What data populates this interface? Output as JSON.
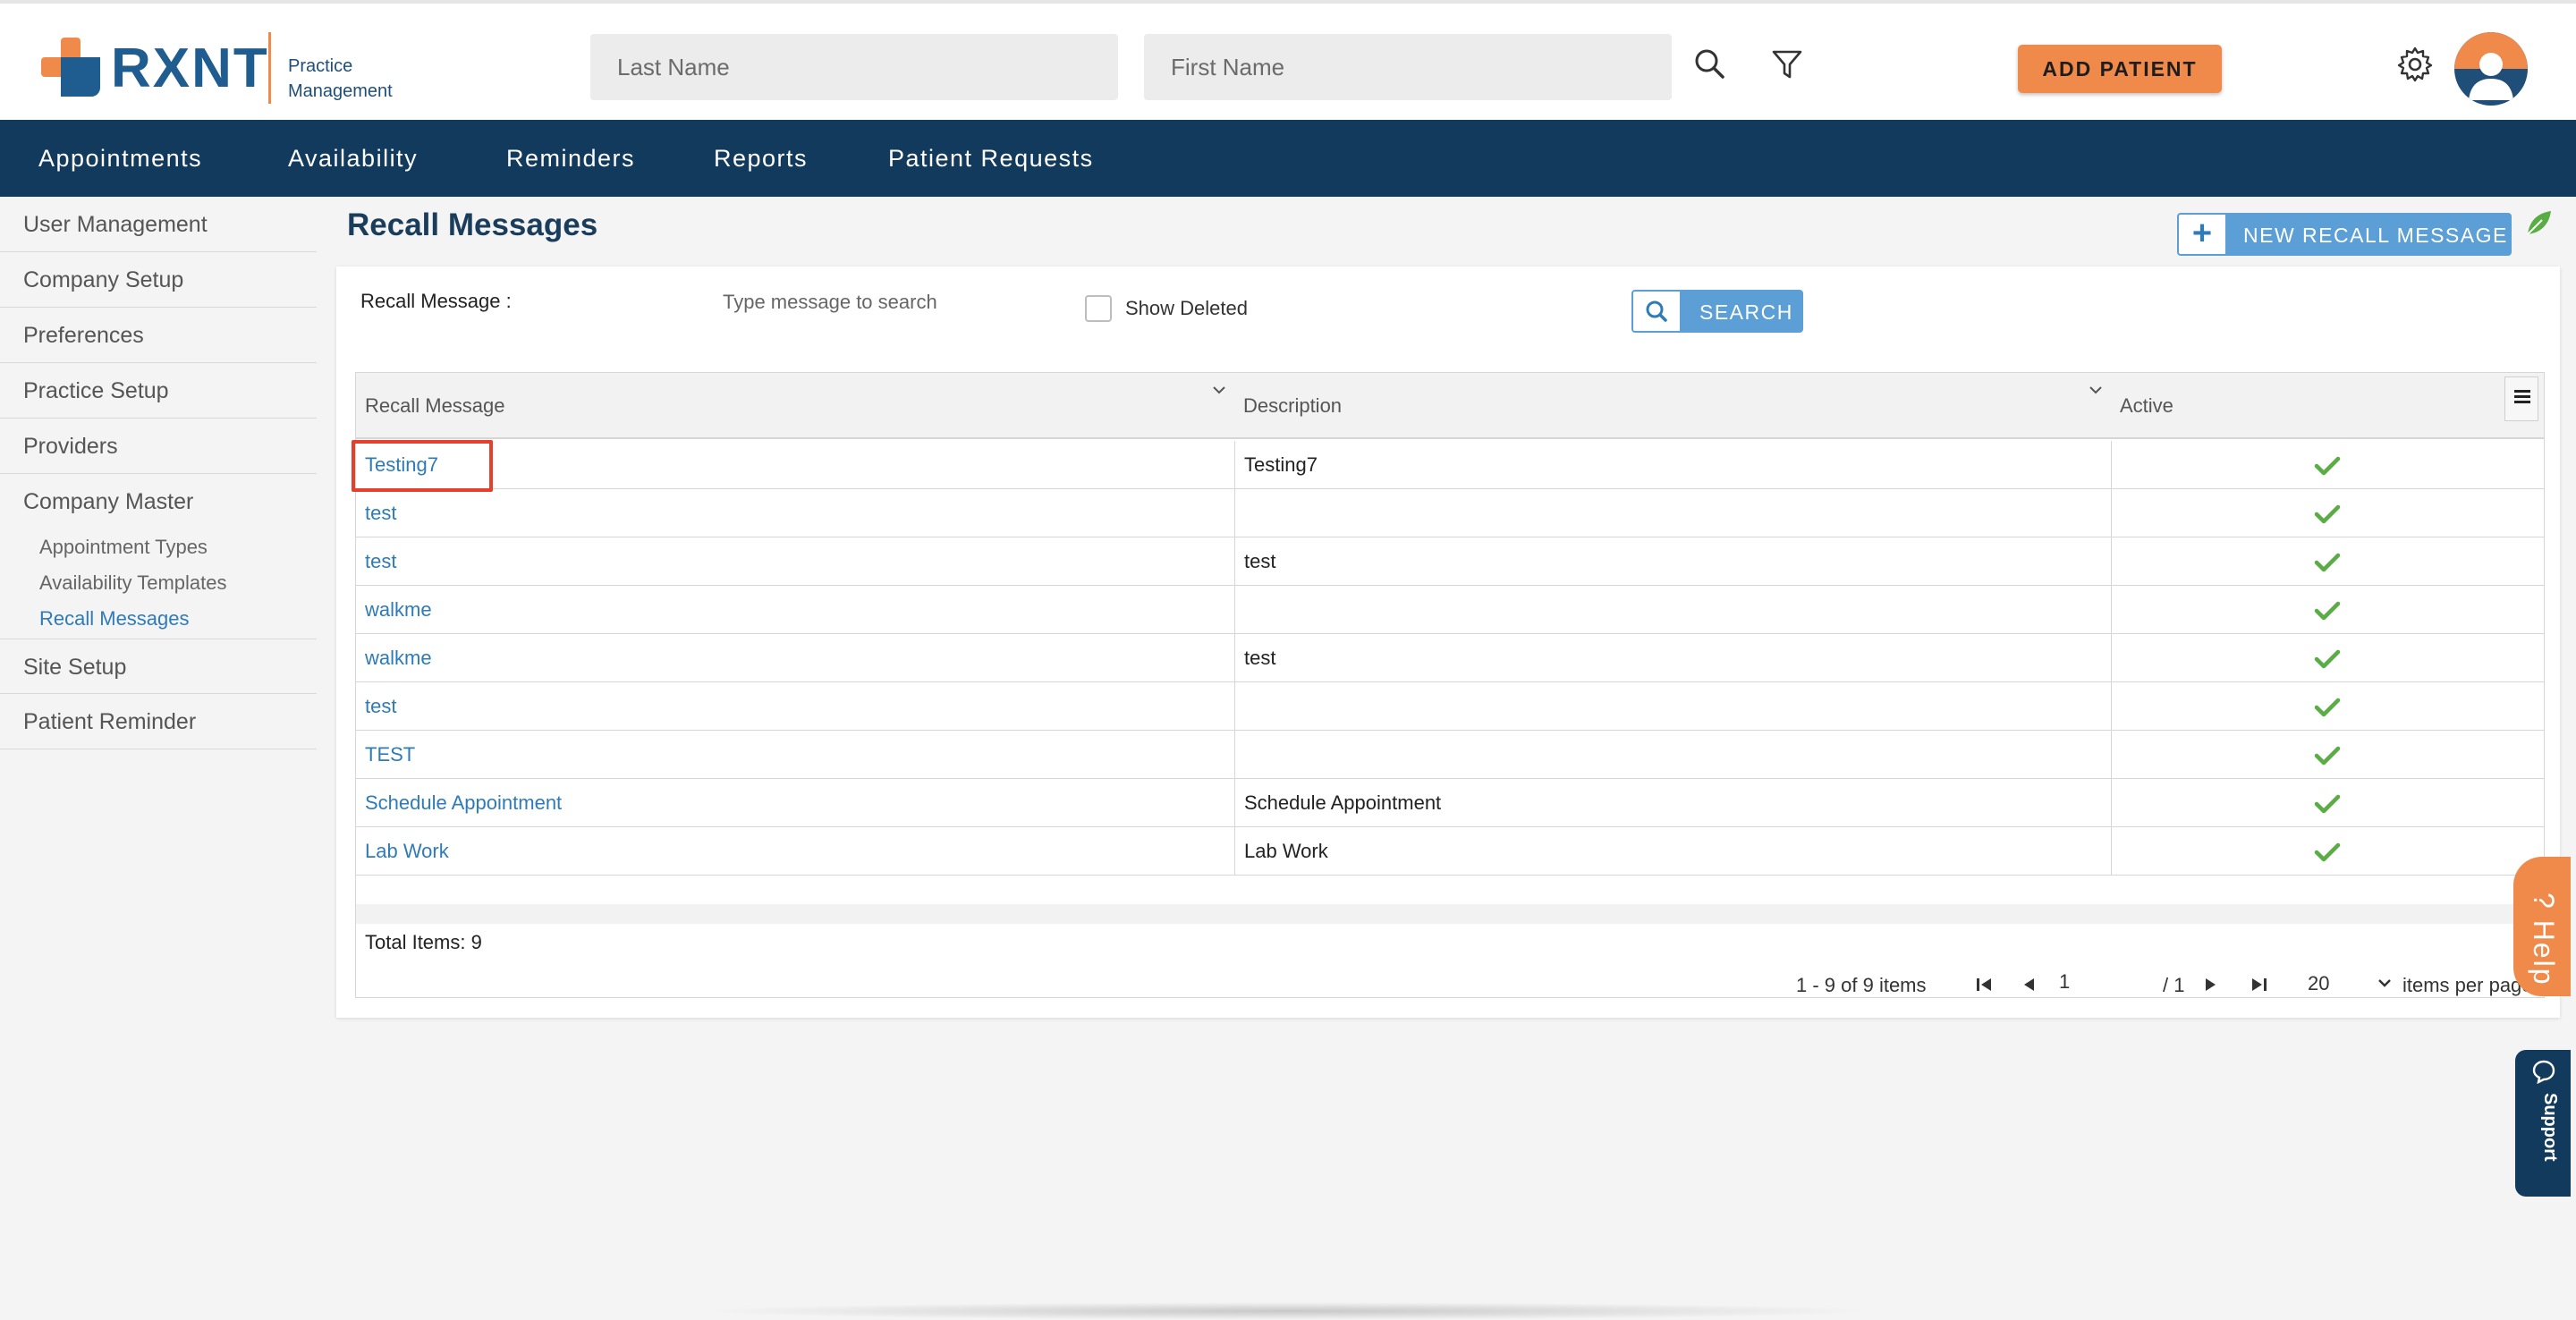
{
  "header": {
    "logo_text": "RXNT",
    "logo_sub_line1": "Practice",
    "logo_sub_line2": "Management",
    "last_name_placeholder": "Last Name",
    "first_name_placeholder": "First Name",
    "search_icon": "search-icon",
    "filter_icon": "filter-icon",
    "add_patient_label": "ADD PATIENT",
    "settings_icon": "gear-icon",
    "avatar_icon": "user-avatar-icon"
  },
  "nav": {
    "items": [
      "Appointments",
      "Availability",
      "Reminders",
      "Reports",
      "Patient Requests"
    ]
  },
  "sidebar": {
    "items": [
      "User Management",
      "Company Setup",
      "Preferences",
      "Practice Setup",
      "Providers",
      "Company Master"
    ],
    "sub_items": [
      "Appointment Types",
      "Availability Templates",
      "Recall Messages"
    ],
    "active_sub": "Recall Messages",
    "after_items": [
      "Site Setup",
      "Patient Reminder"
    ]
  },
  "main": {
    "title": "Recall Messages",
    "new_button_label": "NEW RECALL MESSAGE",
    "filter": {
      "label": "Recall Message :",
      "placeholder": "Type message to search",
      "show_deleted_label": "Show Deleted",
      "search_button_label": "SEARCH"
    },
    "grid": {
      "columns": [
        "Recall Message",
        "Description",
        "Active"
      ],
      "rows": [
        {
          "name": "Testing7",
          "description": "Testing7",
          "active": true
        },
        {
          "name": "test",
          "description": "",
          "active": true
        },
        {
          "name": "test",
          "description": "test",
          "active": true
        },
        {
          "name": "walkme",
          "description": "",
          "active": true
        },
        {
          "name": "walkme",
          "description": "test",
          "active": true
        },
        {
          "name": "test",
          "description": "",
          "active": true
        },
        {
          "name": "TEST",
          "description": "",
          "active": true
        },
        {
          "name": "Schedule Appointment",
          "description": "Schedule Appointment",
          "active": true
        },
        {
          "name": "Lab Work",
          "description": "Lab Work",
          "active": true
        }
      ],
      "total_label": "Total Items: 9",
      "pager_info": "1 - 9 of 9 items",
      "current_page": "1",
      "page_of": "/ 1",
      "per_page": "20",
      "items_per_page_label": "items per page"
    }
  },
  "widgets": {
    "help_label": "? Help",
    "support_label": "Support"
  },
  "colors": {
    "brand_blue": "#1f5c8f",
    "brand_orange": "#f08a4b",
    "nav_bg": "#123a5c",
    "link_blue": "#2e7bb8",
    "check_green": "#5aac44",
    "highlight_red": "#e4402c"
  }
}
